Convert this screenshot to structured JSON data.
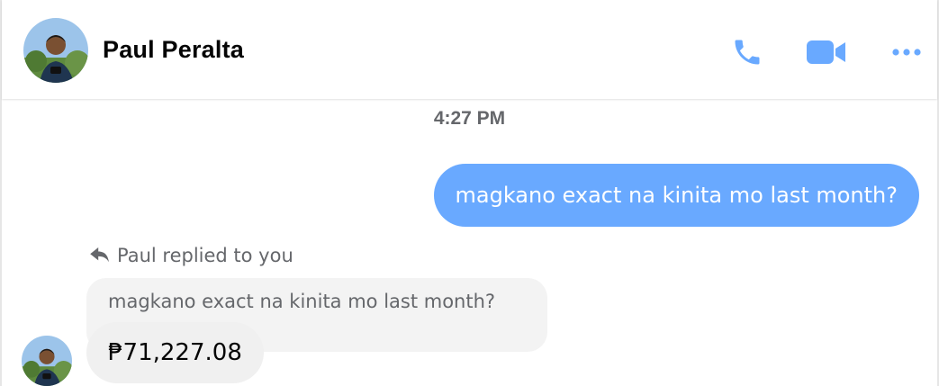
{
  "header": {
    "contact_name": "Paul Peralta",
    "icons": {
      "call": "phone-icon",
      "video": "video-camera-icon",
      "more": "more-dots-icon"
    }
  },
  "thread": {
    "timestamp": "4:27 PM",
    "outgoing_message": "magkano exact na kinita mo last month?",
    "reply_label": "Paul replied to you",
    "quoted_message": "magkano exact na kinita mo last month?",
    "incoming_message": "₱71,227.08"
  },
  "colors": {
    "accent": "#69a9ff",
    "incoming_bubble": "#f0f0f0",
    "secondary_text": "#65676b"
  }
}
